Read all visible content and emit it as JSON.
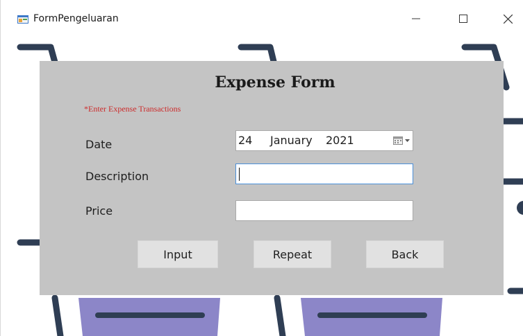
{
  "window": {
    "title": "FormPengeluaran",
    "controls": [
      "minimize",
      "maximize",
      "close"
    ]
  },
  "form": {
    "heading": "Expense Form",
    "hint": "*Enter Expense Transactions",
    "fields": {
      "date": {
        "label": "Date",
        "day": "24",
        "month": "January",
        "year": "2021",
        "picker_icon": "calendar-dropdown-icon"
      },
      "description": {
        "label": "Description",
        "value": ""
      },
      "price": {
        "label": "Price",
        "value": ""
      }
    },
    "buttons": {
      "input": "Input",
      "repeat": "Repeat",
      "back": "Back"
    }
  },
  "colors": {
    "panel": "#c4c4c4",
    "hint": "#cc2b2b",
    "background_art_dark": "#2f3e54",
    "background_art_light": "#8c86c8",
    "focus_border": "#4a8fd8"
  }
}
